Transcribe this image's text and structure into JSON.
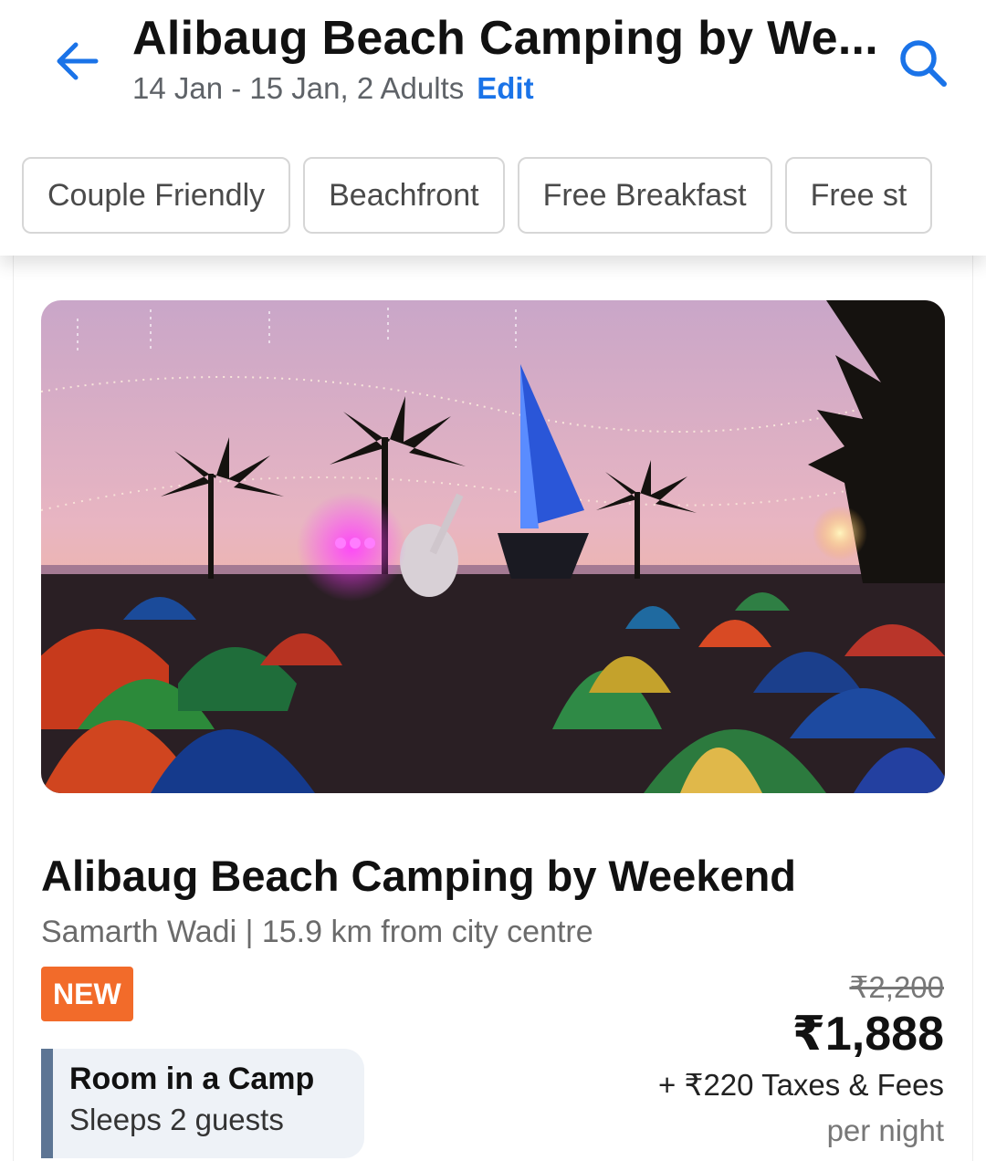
{
  "header": {
    "title": "Alibaug Beach Camping by We...",
    "dates_guests": "14 Jan - 15 Jan, 2 Adults",
    "edit_label": "Edit"
  },
  "filters": [
    "Couple Friendly",
    "Beachfront",
    "Free Breakfast",
    "Free st"
  ],
  "listing": {
    "image_icon": "camp-photo",
    "name": "Alibaug Beach Camping by Weekend",
    "location": "Samarth Wadi | 15.9 km from city centre",
    "badge": "NEW",
    "room_type": "Room in a Camp",
    "room_capacity": "Sleeps 2 guests",
    "original_price": "₹2,200",
    "price": "₹1,888",
    "taxes": "+ ₹220 Taxes & Fees",
    "price_unit": "per night"
  },
  "colors": {
    "accent": "#1a73e8",
    "badge": "#f26b2a",
    "room_bar": "#5d7594"
  }
}
